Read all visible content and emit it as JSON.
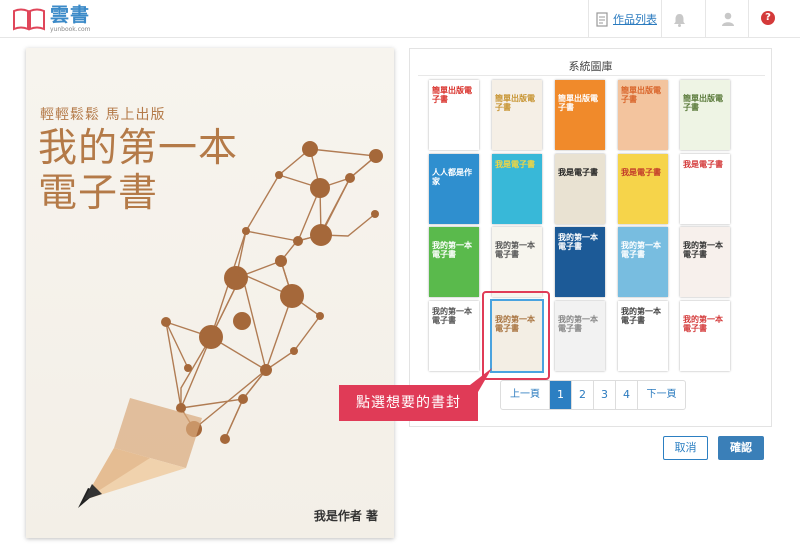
{
  "app": {
    "name": "雲書",
    "domain": "yunbook.com"
  },
  "header": {
    "works_link": "作品列表",
    "help_label": "?"
  },
  "cover": {
    "tagline": "輕輕鬆鬆 馬上出版",
    "title_line1": "我的第一本",
    "title_line2": "電子書",
    "author": "我是作者 著"
  },
  "gallery": {
    "title": "系統圖庫",
    "thumbnails": [
      {
        "label": "簡單出版電子書",
        "color": "#ffffff",
        "accent": "#d9312b"
      },
      {
        "label": "簡單出版電子書",
        "color": "#f5efe6",
        "accent": "#c79431"
      },
      {
        "label": "簡單出版電子書",
        "color": "#f08a2b",
        "accent": "#ffffff"
      },
      {
        "label": "簡單出版電子書",
        "color": "#f3c49e",
        "accent": "#d9652b"
      },
      {
        "label": "簡單出版電子書",
        "color": "#eef4e4",
        "accent": "#5a7a3a"
      },
      {
        "label": "人人都是作家",
        "color": "#2f8fcf",
        "accent": "#ffffff"
      },
      {
        "label": "我是電子書",
        "color": "#38b8d8",
        "accent": "#f3d640"
      },
      {
        "label": "我是電子書",
        "color": "#e9e2d2",
        "accent": "#222222"
      },
      {
        "label": "我是電子書",
        "color": "#f6d44a",
        "accent": "#c23a2a"
      },
      {
        "label": "我是電子書",
        "color": "#ffffff",
        "accent": "#d43a3a"
      },
      {
        "label": "我的第一本電子書",
        "color": "#5aba4c",
        "accent": "#ffffff"
      },
      {
        "label": "我的第一本電子書",
        "color": "#f7f5ee",
        "accent": "#555555"
      },
      {
        "label": "我的第一本電子書",
        "color": "#1c5a97",
        "accent": "#ffffff"
      },
      {
        "label": "我的第一本電子書",
        "color": "#78bde0",
        "accent": "#ffffff"
      },
      {
        "label": "我的第一本電子書",
        "color": "#f7f0ec",
        "accent": "#333333"
      },
      {
        "label": "我的第一本電子書",
        "color": "#ffffff",
        "accent": "#555555"
      },
      {
        "label": "我的第一本電子書",
        "color": "#f3eee4",
        "accent": "#a8733f"
      },
      {
        "label": "我的第一本電子書",
        "color": "#f2f2f2",
        "accent": "#888888"
      },
      {
        "label": "我的第一本電子書",
        "color": "#ffffff",
        "accent": "#444444"
      },
      {
        "label": "我的第一本電子書",
        "color": "#ffffff",
        "accent": "#d43a3a"
      }
    ],
    "selected_index": 16
  },
  "pagination": {
    "prev": "上一頁",
    "pages": [
      "1",
      "2",
      "3",
      "4"
    ],
    "active": "1",
    "next": "下一頁"
  },
  "callout": {
    "text": "點選想要的書封"
  },
  "actions": {
    "cancel": "取消",
    "confirm": "確認"
  }
}
